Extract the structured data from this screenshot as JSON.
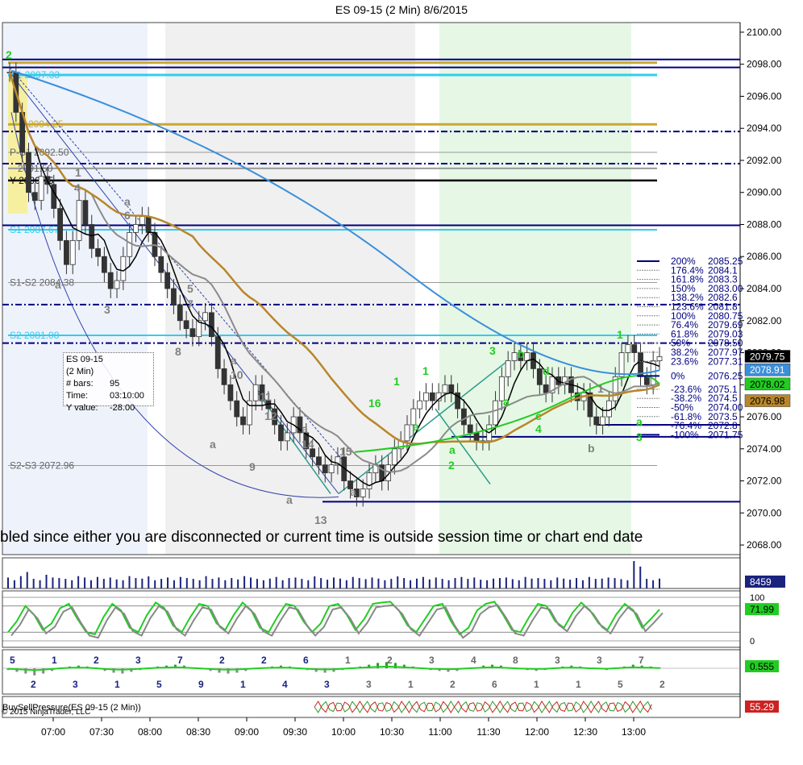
{
  "title": "ES 09-15 (2 Min)  8/6/2015",
  "message": "bled since either you are disconnected or current time is outside session time or chart end date",
  "copyright": "© 2015 NinjaTrader, LLC",
  "infobox": {
    "rows": [
      {
        "k": "ES 09-15 (2 Min)",
        "v": ""
      },
      {
        "k": "# bars:",
        "v": "95"
      },
      {
        "k": "Time:",
        "v": "03:10:00"
      },
      {
        "k": "Y value:",
        "v": "-28.00"
      }
    ]
  },
  "colors": {
    "up_candle": "#2a7a2a",
    "down_candle": "#333333",
    "pivot_line": "#000080",
    "fib_text": "#000080",
    "wave_green": "#22cc22",
    "wave_gray": "#808080",
    "sma_blue": "#3a8fdb",
    "sma_brown": "#b8862a",
    "session_green": "#e6f7e6",
    "session_gray": "#f0f0f0",
    "session_blue": "#eef2fb"
  },
  "chart_data": [
    {
      "type": "line",
      "title": "ES 09-15 (2 Min)  8/6/2015",
      "x_labels": [
        "07:00",
        "07:30",
        "08:00",
        "08:30",
        "09:00",
        "09:30",
        "10:00",
        "10:30",
        "11:00",
        "11:30",
        "12:00",
        "12:30",
        "13:00"
      ],
      "y_ticks": [
        "2100.00",
        "2098.00",
        "2096.00",
        "2094.00",
        "2092.00",
        "2090.00",
        "2088.00",
        "2086.00",
        "2084.00",
        "2082.00",
        "2080.00",
        "2078.00",
        "2076.00",
        "2074.00",
        "2072.00",
        "2070.00",
        "2068.00"
      ],
      "ylim": [
        2067.4,
        2100.6
      ],
      "close_path": [
        2097.5,
        2095.0,
        2092.5,
        2090.0,
        2089.5,
        2091.0,
        2090.5,
        2089.0,
        2087.0,
        2085.5,
        2087.0,
        2089.5,
        2088.0,
        2086.5,
        2086.0,
        2085.0,
        2084.0,
        2084.5,
        2086.0,
        2087.5,
        2088.0,
        2088.5,
        2087.5,
        2086.0,
        2085.0,
        2084.0,
        2083.0,
        2082.0,
        2081.5,
        2081.0,
        2082.0,
        2082.5,
        2081.0,
        2079.0,
        2078.0,
        2077.0,
        2076.0,
        2075.5,
        2077.0,
        2078.0,
        2077.0,
        2076.5,
        2075.5,
        2074.5,
        2075.0,
        2076.0,
        2075.0,
        2074.0,
        2073.5,
        2073.0,
        2072.5,
        2073.0,
        2073.5,
        2072.0,
        2071.5,
        2071.0,
        2071.5,
        2072.5,
        2073.0,
        2072.0,
        2073.0,
        2074.0,
        2074.5,
        2075.5,
        2076.5,
        2077.0,
        2077.5,
        2077.0,
        2077.5,
        2078.0,
        2077.5,
        2076.5,
        2075.5,
        2075.0,
        2074.5,
        2074.5,
        2075.5,
        2077.0,
        2078.5,
        2079.5,
        2080.0,
        2079.5,
        2080.0,
        2079.0,
        2078.0,
        2077.5,
        2078.5,
        2078.0,
        2078.5,
        2077.5,
        2077.0,
        2077.5,
        2076.0,
        2075.5,
        2076.0,
        2077.0,
        2078.5,
        2080.0,
        2080.5,
        2080.0,
        2078.5,
        2078.0,
        2079.5,
        2079.75
      ],
      "price_tags": [
        {
          "label": "2079.75",
          "value": 2079.75,
          "bg": "#000000",
          "fg": "#ffffff"
        },
        {
          "label": "2078.91",
          "value": 2078.91,
          "bg": "#3a8fdb",
          "fg": "#ffffff"
        },
        {
          "label": "2078.02",
          "value": 2078.02,
          "bg": "#22cc22",
          "fg": "#000000"
        },
        {
          "label": "2076.98",
          "value": 2076.98,
          "bg": "#b8862a",
          "fg": "#000000"
        }
      ],
      "pivot_lines": [
        {
          "label": "R1 2097.33",
          "value": 2097.33,
          "color": "#33ccee"
        },
        {
          "label": "S1-S2 2084.38",
          "value": 2084.38,
          "color": "#999999"
        },
        {
          "label": "S1 2087.67",
          "value": 2087.67,
          "color": "#33ccee"
        },
        {
          "label": "S2 2081.08",
          "value": 2081.08,
          "color": "#33ccee"
        },
        {
          "label": "S2-S3 2072.96",
          "value": 2072.96,
          "color": "#999999"
        },
        {
          "label": "2094.25",
          "value": 2094.25,
          "color": "#c9a830"
        },
        {
          "label": "P-S1 2092.50",
          "value": 2092.5,
          "color": "#999999"
        },
        {
          "label": "2091.50",
          "value": 2091.5,
          "color": "#999999"
        },
        {
          "label": "Y 2090.75",
          "value": 2090.75,
          "color": "#000000"
        }
      ],
      "fib_levels": [
        {
          "label": "200%",
          "price": "2085.25"
        },
        {
          "label": "176.4%",
          "price": "2084.1"
        },
        {
          "label": "161.8%",
          "price": "2083.3"
        },
        {
          "label": "150%",
          "price": "2083.00"
        },
        {
          "label": "138.2%",
          "price": "2082.6"
        },
        {
          "label": "123.6%",
          "price": "2081.8"
        },
        {
          "label": "100%",
          "price": "2080.75"
        },
        {
          "label": "76.4%",
          "price": "2079.69"
        },
        {
          "label": "61.8%",
          "price": "2079.03"
        },
        {
          "label": "50%",
          "price": "2078.50"
        },
        {
          "label": "38.2%",
          "price": "2077.97"
        },
        {
          "label": "23.6%",
          "price": "2077.31"
        },
        {
          "label": "0%",
          "price": "2076.25"
        },
        {
          "label": "-23.6%",
          "price": "2075.1"
        },
        {
          "label": "-38.2%",
          "price": "2074.5"
        },
        {
          "label": "-50%",
          "price": "2074.00"
        },
        {
          "label": "-61.8%",
          "price": "2073.5"
        },
        {
          "label": "-76.4%",
          "price": "2072.8"
        },
        {
          "label": "-100%",
          "price": "2071.75"
        }
      ],
      "wave_labels_gray": [
        "1",
        "4",
        "a",
        "6",
        "a",
        "3",
        "5",
        "7",
        "8",
        "a",
        "10",
        "a",
        "9",
        "11",
        "12",
        "a",
        "14",
        "a",
        "13",
        "15",
        "a",
        "b",
        "1",
        "2"
      ],
      "wave_labels_green": [
        "1",
        "16",
        "1",
        "a",
        "3",
        "b",
        "a",
        "d",
        "c",
        "4",
        "a",
        "2",
        "1",
        "a",
        "3"
      ]
    },
    {
      "type": "bar",
      "name": "Volume",
      "last_value": "8459",
      "values": [
        40,
        30,
        45,
        60,
        35,
        30,
        50,
        40,
        38,
        35,
        30,
        45,
        40,
        30,
        42,
        35,
        40,
        33,
        30,
        45,
        38,
        36,
        44,
        30,
        35,
        40,
        30,
        42,
        38,
        35,
        30,
        45,
        35,
        40,
        30,
        38,
        33,
        45,
        40,
        35,
        30,
        36,
        42,
        30,
        38,
        40,
        35,
        30,
        44,
        38,
        32,
        40,
        36,
        30,
        42,
        38,
        34,
        40,
        36,
        30,
        35,
        44,
        38,
        30,
        36,
        42,
        33,
        40,
        35,
        30,
        38,
        42,
        35,
        40,
        32,
        30,
        36,
        38,
        40,
        34,
        30,
        42,
        36,
        38,
        35,
        30,
        40,
        36,
        32,
        38,
        30,
        42,
        35,
        36,
        40,
        38,
        34,
        30,
        100,
        80,
        35,
        30,
        36
      ]
    },
    {
      "type": "line",
      "name": "Stochastic",
      "y_ticks": [
        "100",
        "0"
      ],
      "last_value": "71.99",
      "values": [
        20,
        45,
        80,
        60,
        25,
        40,
        75,
        85,
        50,
        20,
        15,
        55,
        85,
        70,
        30,
        20,
        60,
        88,
        75,
        35,
        20,
        55,
        85,
        80,
        40,
        25,
        60,
        88,
        70,
        30,
        20,
        55,
        85,
        80,
        45,
        20,
        40,
        80,
        85,
        60,
        25,
        50,
        85,
        88,
        90,
        70,
        35,
        20,
        50,
        80,
        85,
        45,
        15,
        30,
        70,
        85,
        90,
        60,
        25,
        20,
        55,
        85,
        80,
        45,
        30,
        65,
        88,
        70,
        40,
        25,
        60,
        85,
        70,
        30,
        50,
        72
      ]
    },
    {
      "type": "bar",
      "name": "Momentum histogram",
      "last_value": "0.555",
      "values": [
        -2,
        -4,
        -6,
        -8,
        -6,
        -3,
        0,
        2,
        3,
        2,
        0,
        -3,
        -5,
        -6,
        -4,
        -2,
        0,
        2,
        3,
        4,
        3,
        1,
        -1,
        -3,
        -5,
        -6,
        -5,
        -3,
        -1,
        1,
        2,
        3,
        2,
        0,
        -2,
        -4,
        -5,
        -4,
        -2,
        0,
        2,
        4,
        6,
        7,
        6,
        4,
        2,
        0,
        -2,
        -3,
        -4,
        -3,
        -1,
        1,
        3,
        4,
        3,
        1,
        -1,
        -2,
        -3,
        -2,
        0,
        2,
        3,
        2,
        0,
        -1,
        -2,
        0,
        2,
        4,
        3,
        2,
        1
      ],
      "wave_numbers": [
        "5",
        "2",
        "1",
        "3",
        "2",
        "1",
        "3",
        "5",
        "7",
        "9",
        "2",
        "1",
        "2",
        "4",
        "6",
        "3",
        "1",
        "3",
        "2",
        "1",
        "3",
        "2",
        "4",
        "6",
        "8",
        "1",
        "3",
        "1",
        "3",
        "5",
        "7",
        "2"
      ]
    },
    {
      "type": "line",
      "name": "BuySellPressure(ES 09-15 (2 Min))",
      "last_value": "55.29"
    }
  ]
}
